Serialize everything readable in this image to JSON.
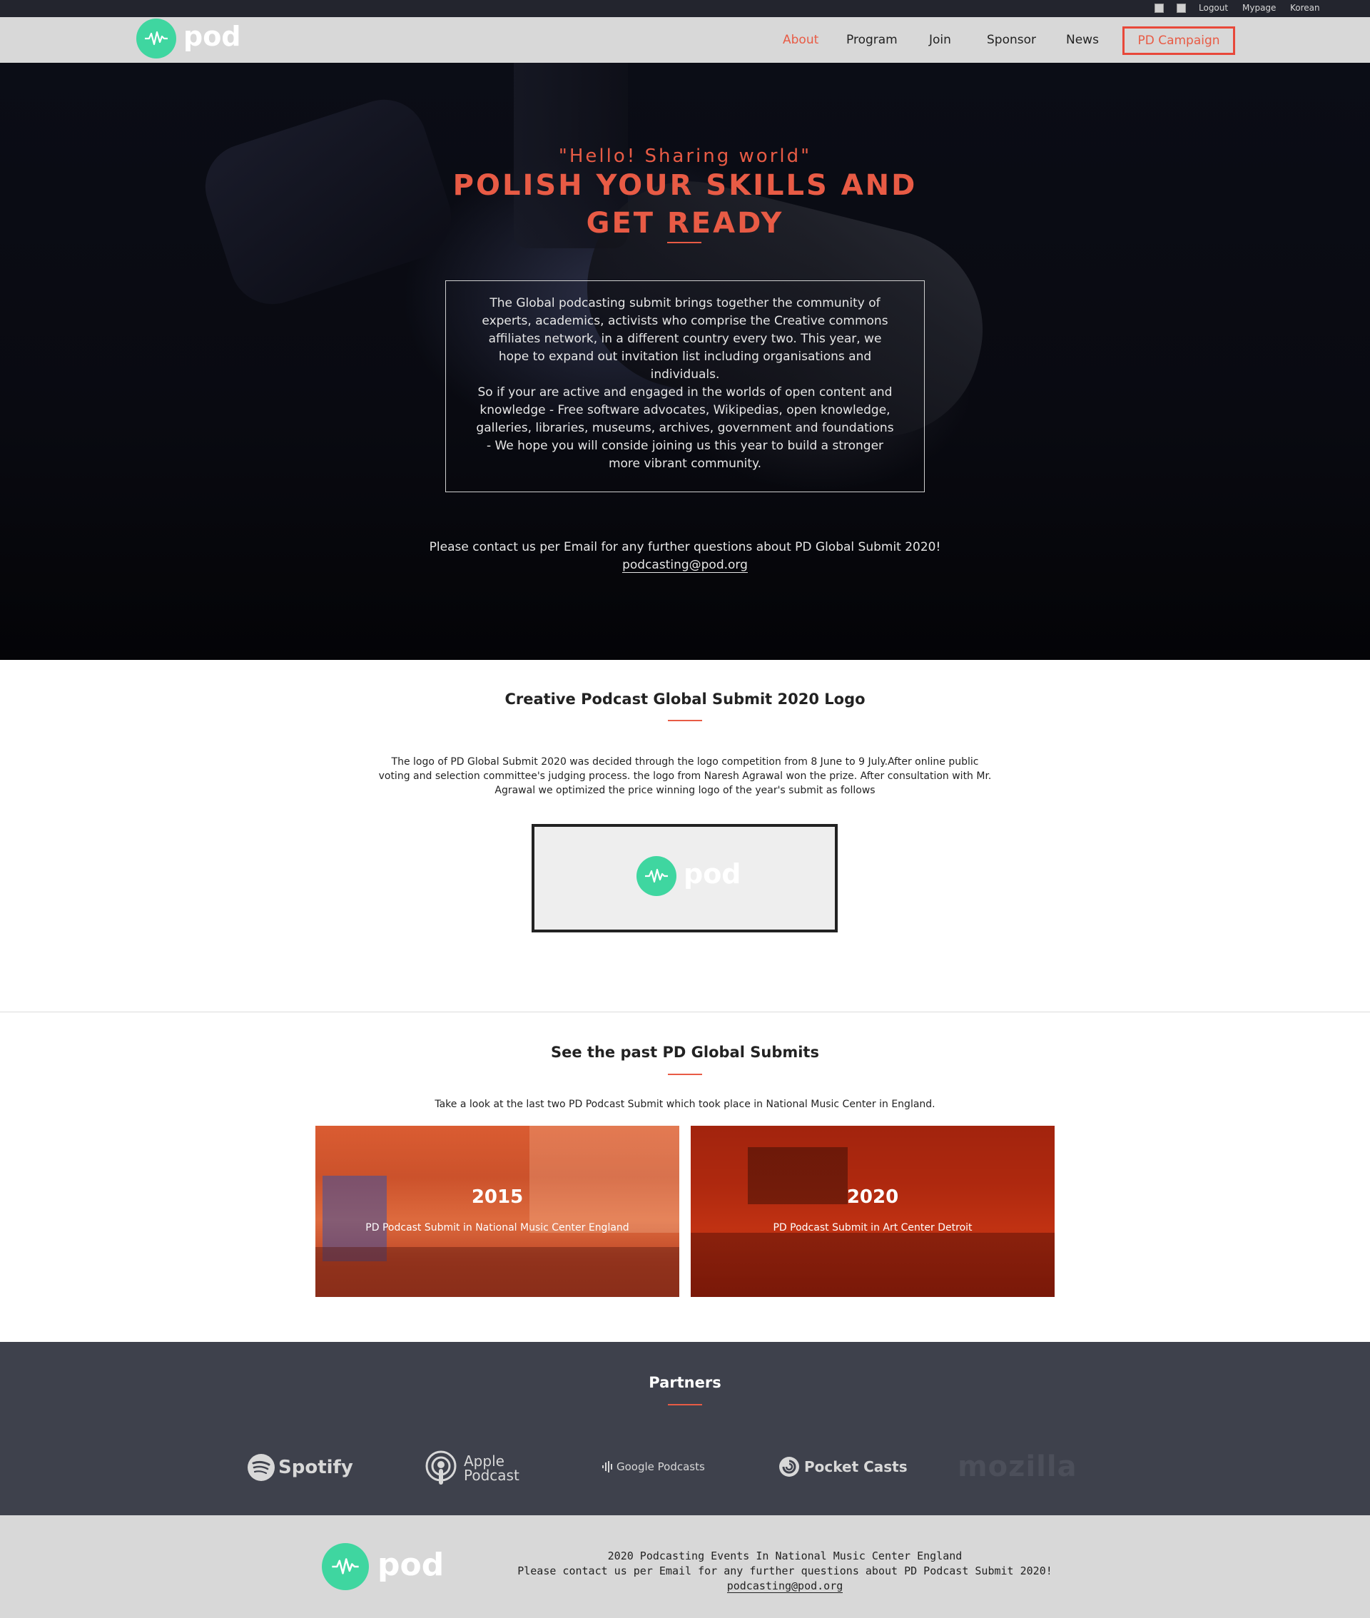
{
  "topbar": {
    "logout": "Logout",
    "mypage": "Mypage",
    "language": "Korean"
  },
  "brand": {
    "name": "pod",
    "accent": "#3fd6a0"
  },
  "nav": {
    "about": "About",
    "program": "Program",
    "join": "Join",
    "sponsor": "Sponsor",
    "news": "News",
    "campaign": "PD Campaign"
  },
  "hero": {
    "quote": "\"Hello! Sharing world\"",
    "title_line1": "POLISH YOUR SKILLS AND",
    "title_line2": "GET READY",
    "box_text_1": "The Global podcasting submit brings together the community of experts, academics, activists who comprise the Creative commons affiliates network, in a different country every two. This year, we hope to expand out invitation list including organisations and individuals.",
    "box_text_2": "So if your are active and engaged in the worlds of open content and knowledge - Free software advocates, Wikipedias, open knowledge, galleries, libraries, museums, archives, government and foundations - We hope you will conside joining us this year to build a stronger more vibrant community.",
    "contact": "Please contact us per Email for any further questions about PD Global Submit 2020!",
    "email": "podcasting@pod.org"
  },
  "logo_section": {
    "title": "Creative Podcast Global Submit 2020 Logo",
    "text": "The logo of PD Global Submit 2020 was decided through the logo competition from 8 June to 9 July.After online public voting and selection committee's judging process. the logo from Naresh Agrawal won the prize. After consultation with Mr. Agrawal we optimized the price winning logo of the year's submit as follows"
  },
  "past_section": {
    "title": "See the past PD Global Submits",
    "text": "Take a look at the last two PD Podcast Submit which took place in National Music Center in England.",
    "cards": [
      {
        "year": "2015",
        "caption": "PD Podcast Submit in National Music Center England"
      },
      {
        "year": "2020",
        "caption": "PD Podcast Submit in Art Center Detroit"
      }
    ]
  },
  "partners": {
    "title": "Partners",
    "spotify": "Spotify",
    "apple_line1": "Apple",
    "apple_line2": "Podcast",
    "google": "Google Podcasts",
    "pocketcasts": "Pocket Casts",
    "mozilla": "mozilla"
  },
  "footer": {
    "line1": "2020 Podcasting Events In National Music Center England",
    "line2": "Please contact us per Email for any further questions about PD Podcast Submit 2020!",
    "email": "podcasting@pod.org"
  },
  "colors": {
    "accent": "#e85b45",
    "topbar": "#23252e",
    "header": "#d8d8d8",
    "partners_bg": "#3e414c"
  }
}
